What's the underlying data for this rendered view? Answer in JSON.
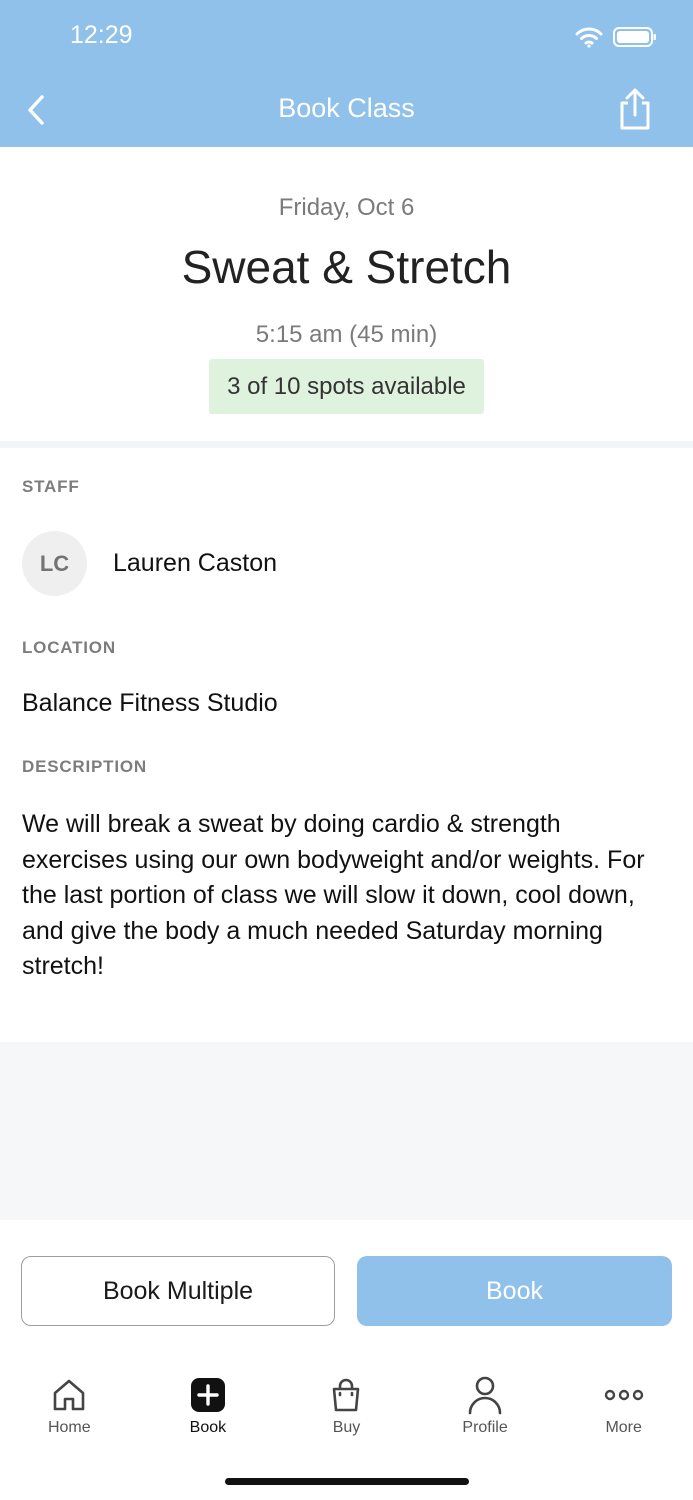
{
  "status_bar": {
    "time": "12:29"
  },
  "nav": {
    "title": "Book Class"
  },
  "class": {
    "date": "Friday, Oct 6",
    "title": "Sweat & Stretch",
    "time": "5:15 am (45 min)",
    "availability": "3 of 10 spots available"
  },
  "staff": {
    "label": "STAFF",
    "initials": "LC",
    "name": "Lauren Caston"
  },
  "location": {
    "label": "LOCATION",
    "name": "Balance Fitness Studio"
  },
  "description": {
    "label": "DESCRIPTION",
    "text": "We will break a sweat by doing cardio & strength exercises using our own bodyweight and/or weights. For the last portion of class we will slow it down, cool down, and give the body a much needed Saturday morning stretch!"
  },
  "actions": {
    "book_multiple": "Book Multiple",
    "book": "Book"
  },
  "tabs": [
    {
      "label": "Home",
      "icon": "home-icon"
    },
    {
      "label": "Book",
      "icon": "plus-square-icon"
    },
    {
      "label": "Buy",
      "icon": "shopping-bag-icon"
    },
    {
      "label": "Profile",
      "icon": "person-icon"
    },
    {
      "label": "More",
      "icon": "more-dots-icon"
    }
  ],
  "colors": {
    "header": "#8fc1ea",
    "availability_bg": "#dff2de",
    "book_button": "#8fc1ea"
  }
}
